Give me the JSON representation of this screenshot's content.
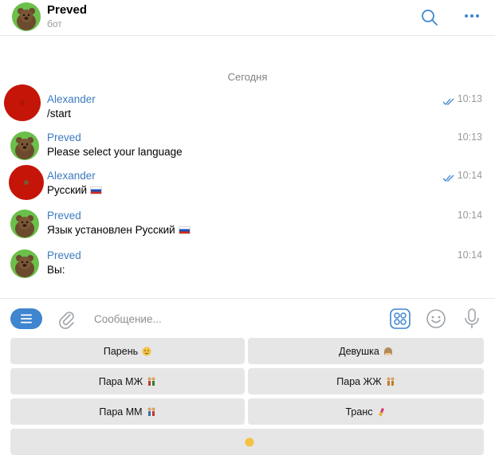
{
  "header": {
    "name": "Preved",
    "subtitle": "бот"
  },
  "chat": {
    "date_separator": "Сегодня",
    "messages": [
      {
        "author": "Alexander",
        "text": "/start",
        "time": "10:13",
        "read": true
      },
      {
        "author": "Preved",
        "text": "Please select your language",
        "time": "10:13",
        "read": false
      },
      {
        "author": "Alexander",
        "text": "Русский",
        "time": "10:14",
        "read": true
      },
      {
        "author": "Preved",
        "text": "Язык установлен Русский",
        "time": "10:14",
        "read": false
      },
      {
        "author": "Preved",
        "text": "Вы:",
        "time": "10:14",
        "read": false
      }
    ]
  },
  "composer": {
    "placeholder": "Сообщение..."
  },
  "keyboard": {
    "rows": [
      [
        "Парень",
        "Девушка"
      ],
      [
        "Пара МЖ",
        "Пара ЖЖ"
      ],
      [
        "Пара ММ",
        "Транс"
      ]
    ]
  },
  "colors": {
    "accent": "#3f85cf",
    "author": "#3e7bbf",
    "user_avatar": "#c41508",
    "bot_avatar": "#6bbf4a"
  }
}
